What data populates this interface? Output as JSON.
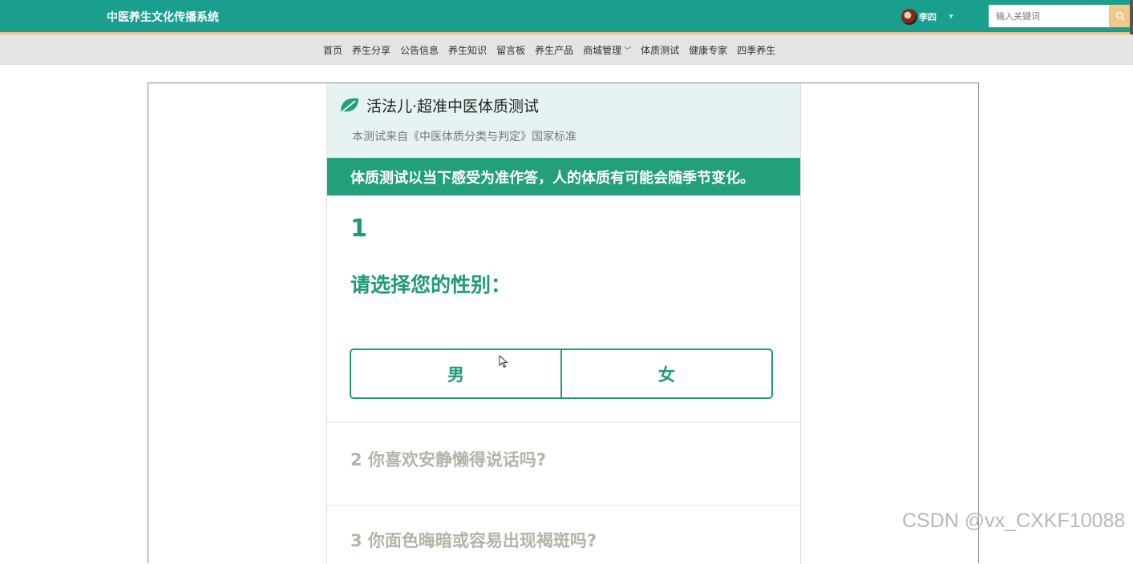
{
  "header": {
    "site_title": "中医养生文化传播系统",
    "user_name": "李四",
    "caret": "▾",
    "search_placeholder": "输入关键词",
    "search_icon": "search-icon",
    "colors": {
      "bar": "#1a9f8f",
      "accent": "#f0c98a"
    }
  },
  "nav": {
    "items": [
      "首页",
      "养生分享",
      "公告信息",
      "养生知识",
      "留言板",
      "养生产品",
      "商城管理",
      "体质测试",
      "健康专家",
      "四季养生"
    ],
    "dropdown_arrow": "﹀"
  },
  "quiz": {
    "title": "活法儿·超准中医体质测试",
    "subtitle": "本测试来自《中医体质分类与判定》国家标准",
    "banner": "体质测试以当下感受为准作答，人的体质有可能会随季节变化。",
    "current_number": "1",
    "current_question": "请选择您的性别：",
    "options": [
      "男",
      "女"
    ],
    "next_questions": [
      "2 你喜欢安静懒得说话吗?",
      "3 你面色晦暗或容易出现褐斑吗?"
    ],
    "colors": {
      "primary": "#1f9a78",
      "header_bg": "#e7f3f3",
      "muted": "#b4b4a6"
    }
  },
  "watermark": "CSDN @vx_CXKF10088"
}
